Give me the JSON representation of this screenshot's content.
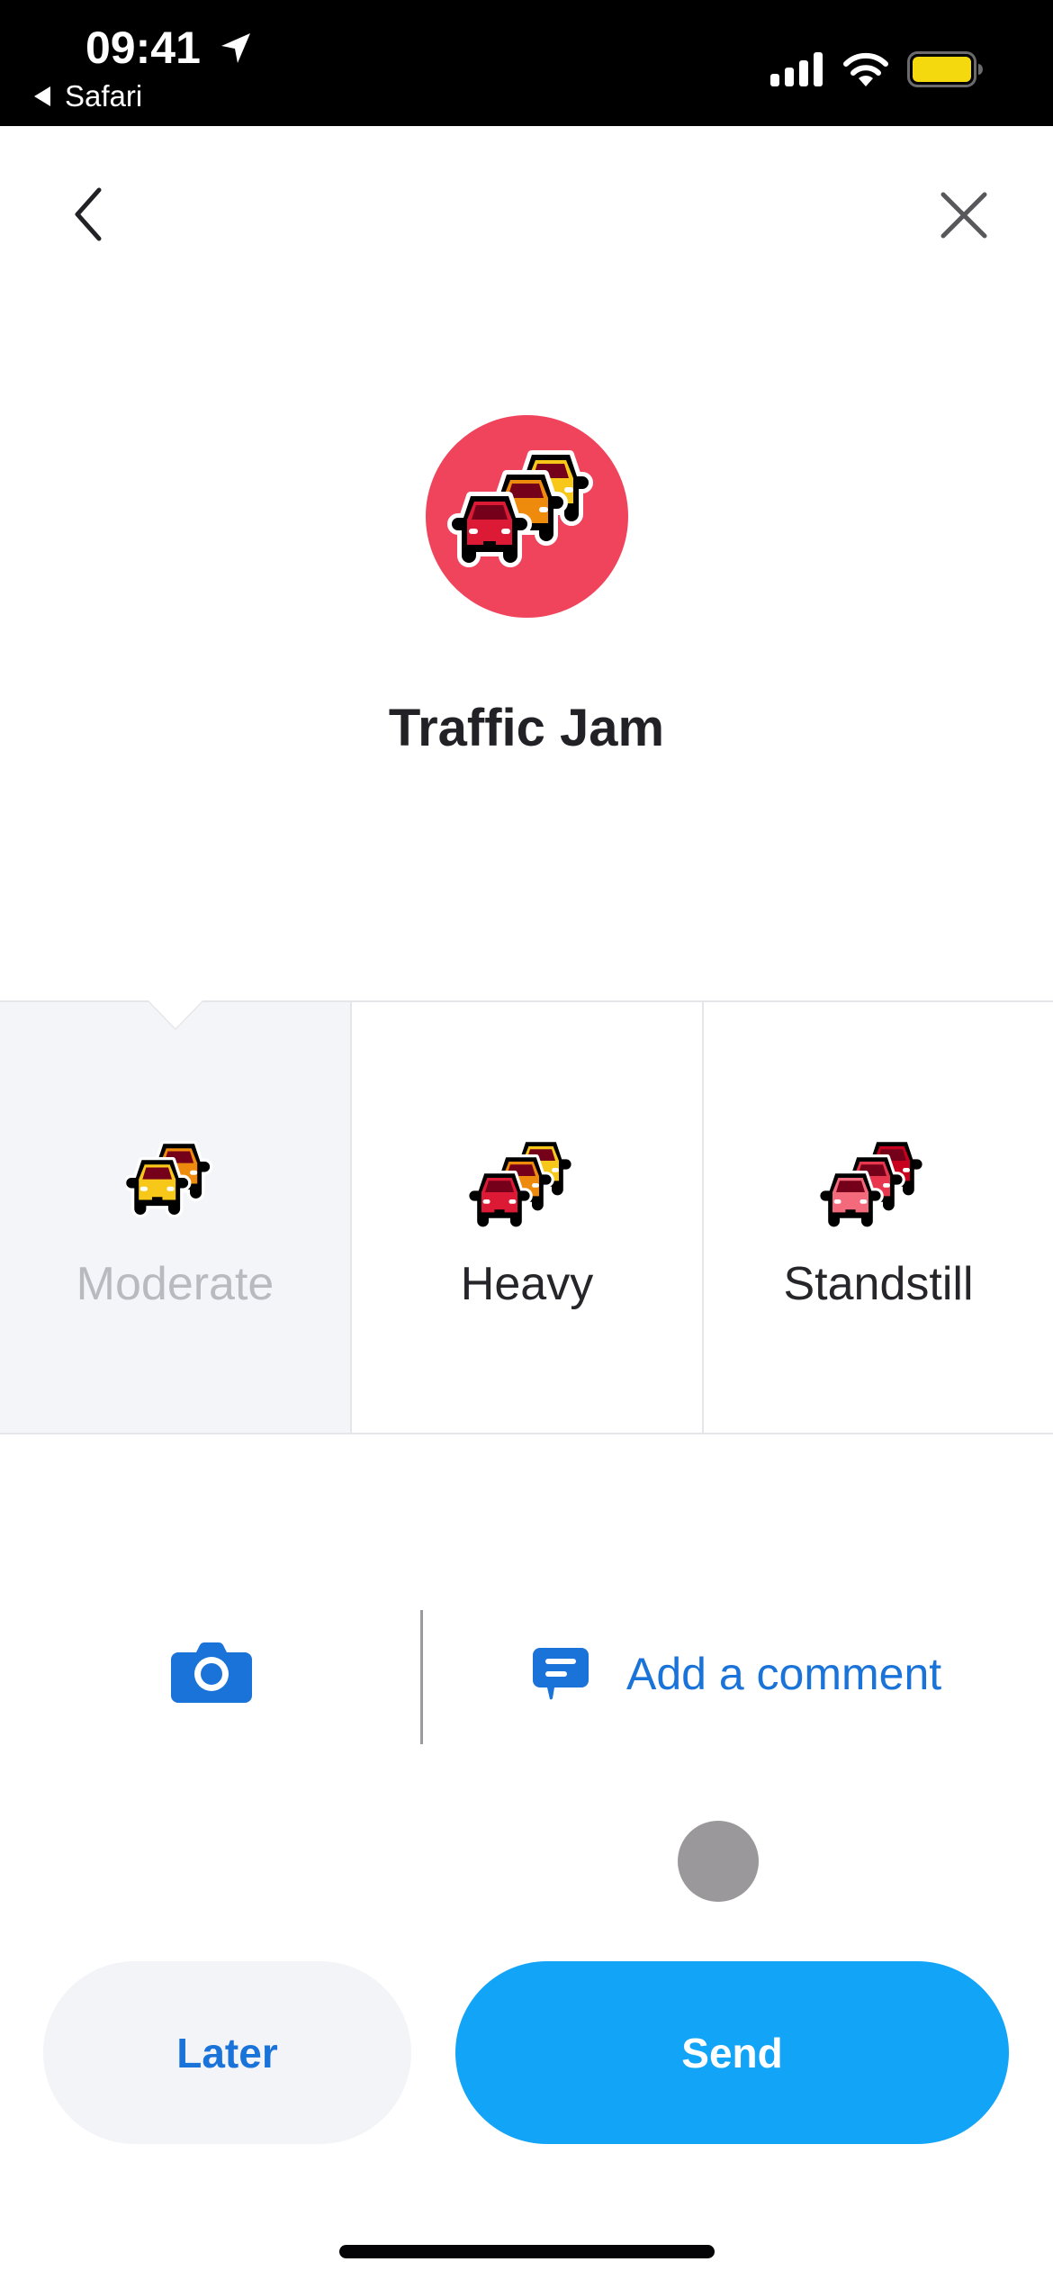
{
  "status_bar": {
    "time": "09:41",
    "back_app": "Safari",
    "icons": [
      "location-arrow-icon",
      "signal-icon",
      "wifi-icon",
      "battery-icon"
    ],
    "battery_color": "#f5d90f"
  },
  "nav": {
    "back_icon": "chevron-left-icon",
    "close_icon": "close-icon"
  },
  "report": {
    "icon": "traffic-jam-icon",
    "icon_bg": "#f0435c",
    "title": "Traffic Jam"
  },
  "severity": {
    "selected_index": 0,
    "options": [
      {
        "label": "Moderate",
        "icon": "moderate-traffic-icon",
        "selected": true
      },
      {
        "label": "Heavy",
        "icon": "heavy-traffic-icon",
        "selected": false
      },
      {
        "label": "Standstill",
        "icon": "standstill-traffic-icon",
        "selected": false
      }
    ]
  },
  "actions": {
    "camera_icon": "camera-icon",
    "comment_icon": "comment-icon",
    "comment_label": "Add a comment",
    "accent": "#1a73d9"
  },
  "buttons": {
    "later": "Later",
    "send": "Send",
    "send_color": "#12a4f7"
  }
}
